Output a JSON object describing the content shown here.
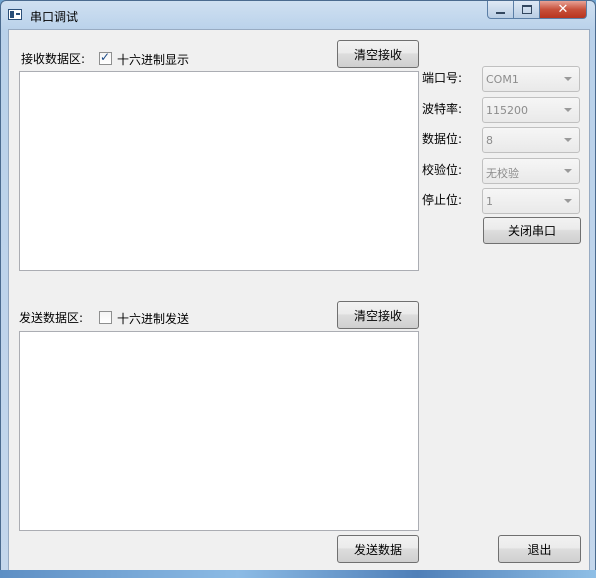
{
  "window": {
    "title": "串口调试",
    "buttons": {
      "minimize": "minimize-icon",
      "maximize": "maximize-icon",
      "close": "close-icon"
    }
  },
  "receive": {
    "label": "接收数据区:",
    "hex_checkbox_label": "十六进制显示",
    "hex_checked": true,
    "clear_button": "清空接收",
    "content": ""
  },
  "send": {
    "label": "发送数据区:",
    "hex_checkbox_label": "十六进制发送",
    "hex_checked": false,
    "clear_button": "清空接收",
    "content": "",
    "send_button": "发送数据"
  },
  "settings": {
    "port": {
      "label": "端口号:",
      "value": "COM1"
    },
    "baud": {
      "label": "波特率:",
      "value": "115200"
    },
    "databits": {
      "label": "数据位:",
      "value": "8"
    },
    "parity": {
      "label": "校验位:",
      "value": "无校验"
    },
    "stopbits": {
      "label": "停止位:",
      "value": "1"
    },
    "toggle_button": "关闭串口"
  },
  "exit_button": "退出",
  "colors": {
    "close_button": "#c7503b",
    "client_bg": "#f0f0f0",
    "title_bar": "#cfe0f1"
  }
}
